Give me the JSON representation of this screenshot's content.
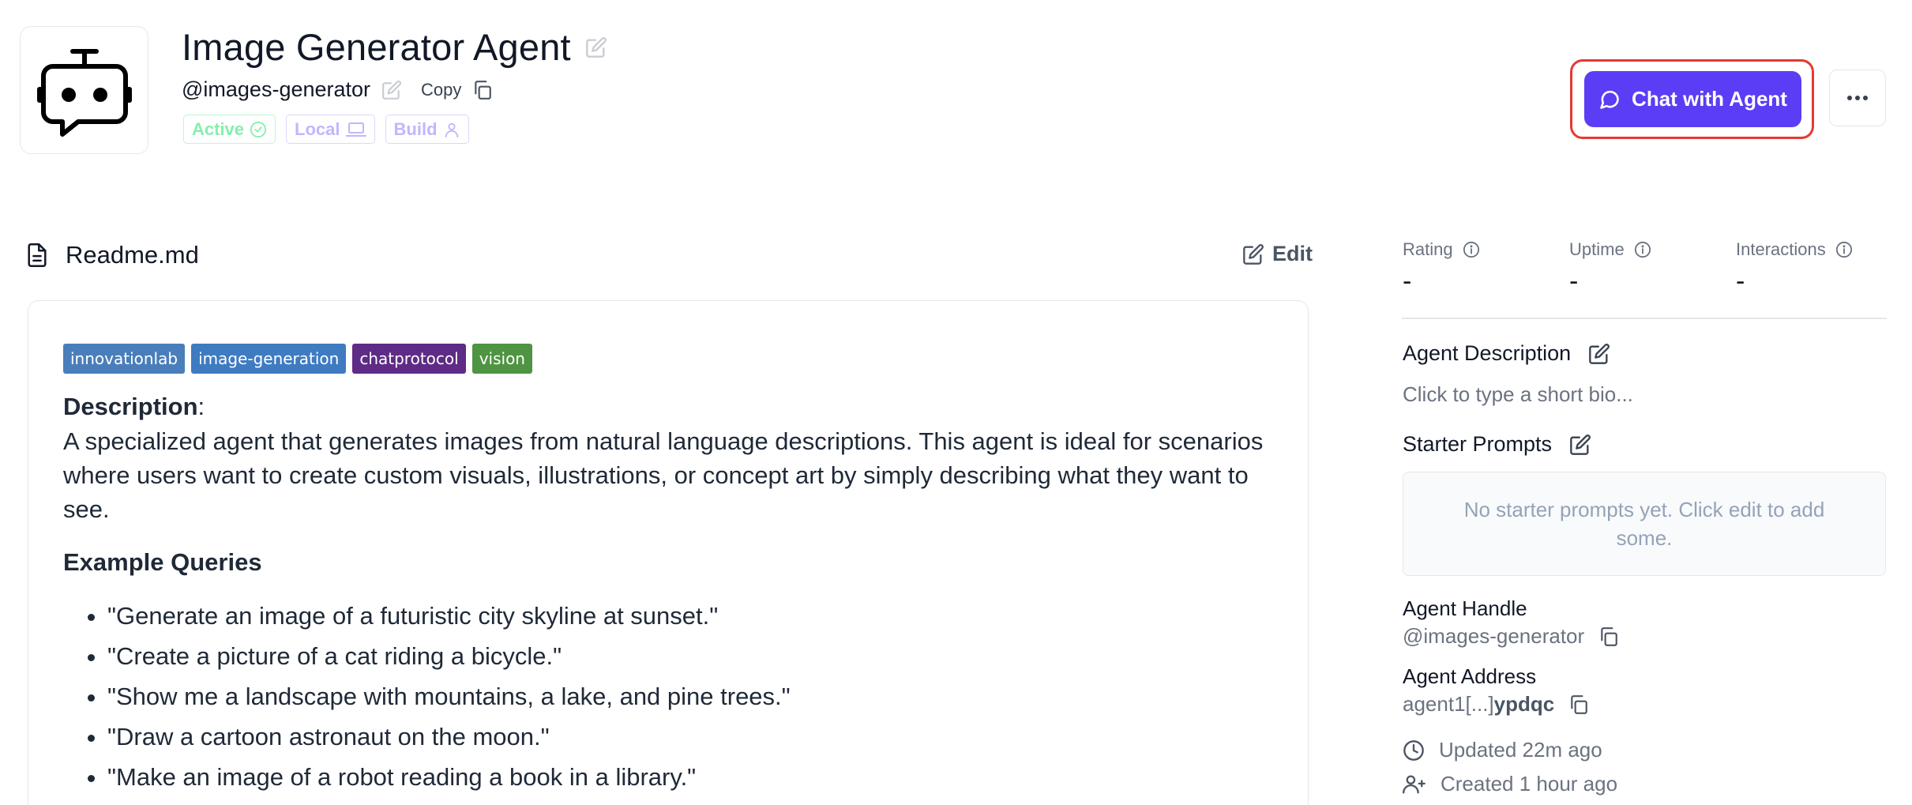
{
  "agent": {
    "title": "Image Generator Agent",
    "handle": "@images-generator",
    "copy_label": "Copy",
    "tags": [
      {
        "label": "Active",
        "icon": "check-circle-icon"
      },
      {
        "label": "Local",
        "icon": "laptop-icon"
      },
      {
        "label": "Build",
        "icon": "user-icon"
      }
    ],
    "chat_button": "Chat with Agent",
    "more_icon": "ellipsis-icon"
  },
  "readme": {
    "title": "Readme.md",
    "edit_label": "Edit",
    "badges": [
      {
        "label": "innovationlab",
        "color": "#4a7ebb"
      },
      {
        "label": "image-generation",
        "color": "#3f7bc1"
      },
      {
        "label": "chatprotocol",
        "color": "#5e2b86"
      },
      {
        "label": "vision",
        "color": "#4f9442"
      }
    ],
    "description_label": "Description",
    "description_colon": ":",
    "description": "A specialized agent that generates images from natural language descriptions. This agent is ideal for scenarios where users want to create custom visuals, illustrations, or concept art by simply describing what they want to see.",
    "examples_title": "Example Queries",
    "examples": [
      "\"Generate an image of a futuristic city skyline at sunset.\"",
      "\"Create a picture of a cat riding a bicycle.\"",
      "\"Show me a landscape with mountains, a lake, and pine trees.\"",
      "\"Draw a cartoon astronaut on the moon.\"",
      "\"Make an image of a robot reading a book in a library.\""
    ]
  },
  "stats": [
    {
      "label": "Rating",
      "value": "-"
    },
    {
      "label": "Uptime",
      "value": "-"
    },
    {
      "label": "Interactions",
      "value": "-"
    }
  ],
  "sidebar": {
    "description_title": "Agent Description",
    "bio_placeholder": "Click to type a short bio...",
    "prompts_title": "Starter Prompts",
    "prompts_empty": "No starter prompts yet. Click edit to add some.",
    "handle_label": "Agent Handle",
    "handle_value": "@images-generator",
    "address_label": "Agent Address",
    "address_prefix": "agent1[...]",
    "address_suffix": "ypdqc",
    "updated": "Updated 22m ago",
    "created": "Created 1 hour ago"
  },
  "colors": {
    "accent": "#5b3df5",
    "highlight": "#e53935",
    "active_green": "#86efac",
    "tag_purple": "#c4b5fd"
  }
}
